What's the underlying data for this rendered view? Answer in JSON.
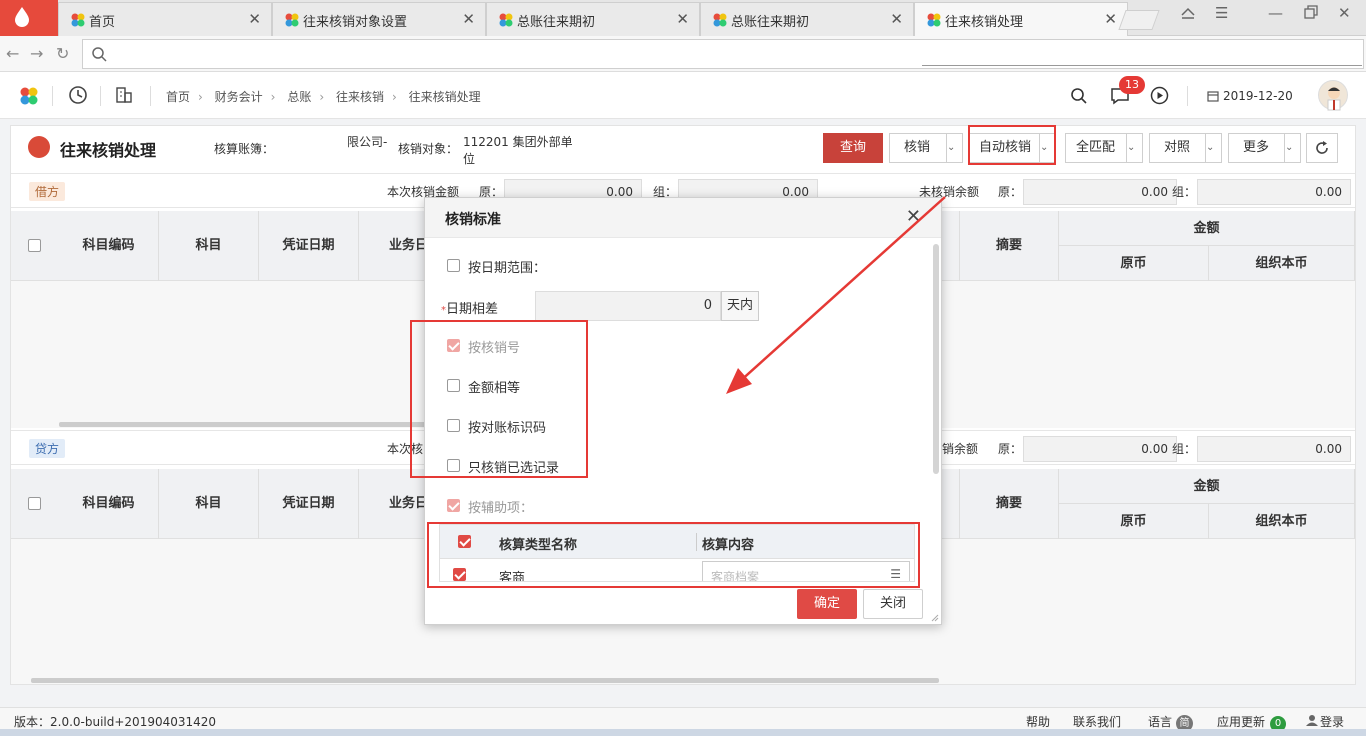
{
  "browser": {
    "tabs": [
      {
        "label": "首页"
      },
      {
        "label": "往来核销对象设置"
      },
      {
        "label": "总账往来期初"
      },
      {
        "label": "总账往来期初"
      },
      {
        "label": "往来核销处理"
      }
    ]
  },
  "header": {
    "breadcrumb": [
      "首页",
      "财务会计",
      "总账",
      "往来核销",
      "往来核销处理"
    ],
    "notification_count": "13",
    "date": "2019-12-20"
  },
  "page": {
    "title": "往来核销处理",
    "ledger_label": "核算账簿：",
    "ledger_suffix": "限公司-",
    "object_label": "核销对象：",
    "object_value_line1": "112201 集团外部单",
    "object_value_line2": "位"
  },
  "toolbar": {
    "query": "查询",
    "verify": "核销",
    "auto_verify": "自动核销",
    "match_all": "全匹配",
    "reconcile": "对照",
    "more": "更多"
  },
  "debit": {
    "tag": "借方",
    "amount_label": "本次核销金额",
    "orig_label": "原：",
    "org_label": "组：",
    "orig_value": "0.00",
    "org_value": "0.00",
    "remain_label": "未核销余额",
    "remain_orig": "0.00",
    "remain_org": "0.00"
  },
  "credit": {
    "tag": "贷方",
    "amount_label": "本次核",
    "remain_label": "销余额",
    "orig_label": "原：",
    "org_label": "组：",
    "remain_orig": "0.00",
    "remain_org": "0.00"
  },
  "columns": {
    "account_code": "科目编码",
    "account": "科目",
    "voucher_date": "凭证日期",
    "business_date": "业务日",
    "summary": "摘要",
    "amount": "金额",
    "original": "原币",
    "org_currency": "组织本币"
  },
  "dialog": {
    "title": "核销标准",
    "by_date_range": "按日期范围：",
    "date_diff_label": "日期相差",
    "date_diff_value": "0",
    "date_unit": "天内",
    "by_verify_no": "按核销号",
    "amount_equal": "金额相等",
    "by_reconcile_code": "按对账标识码",
    "only_selected": "只核销已选记录",
    "by_aux": "按辅助项：",
    "aux_col_type": "核算类型名称",
    "aux_col_content": "核算内容",
    "aux_row_type": "客商",
    "aux_row_placeholder": "客商档案",
    "ok": "确定",
    "close": "关闭"
  },
  "status": {
    "version": "版本：2.0.0-build+201904031420",
    "help": "帮助",
    "contact": "联系我们",
    "language": "语言",
    "language_badge": "简",
    "update": "应用更新",
    "update_count": "0",
    "login": "登录"
  },
  "colors": {
    "accent_red": "#e04a45",
    "annotation_red": "#e53935",
    "brand_red": "#e64a3c"
  }
}
